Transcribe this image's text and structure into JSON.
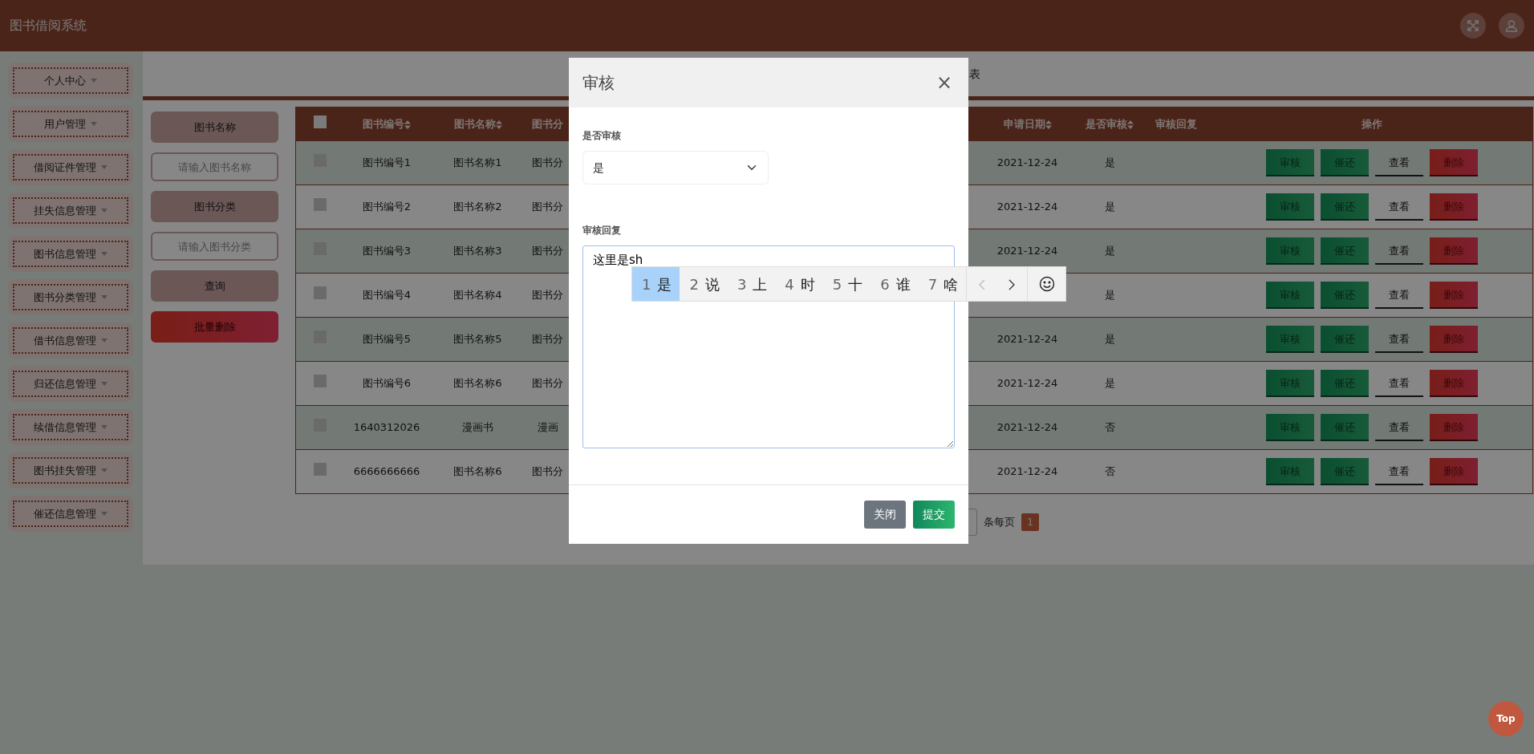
{
  "header": {
    "title": "图书借阅系统"
  },
  "sidebar": {
    "items": [
      {
        "label": "个人中心"
      },
      {
        "label": "用户管理"
      },
      {
        "label": "借阅证件管理"
      },
      {
        "label": "挂失信息管理"
      },
      {
        "label": "图书信息管理"
      },
      {
        "label": "图书分类管理"
      },
      {
        "label": "借书信息管理"
      },
      {
        "label": "归还信息管理"
      },
      {
        "label": "续借信息管理"
      },
      {
        "label": "图书挂失管理"
      },
      {
        "label": "催还信息管理"
      }
    ]
  },
  "page_title": "表",
  "search": {
    "fields": [
      {
        "label": "图书名称",
        "placeholder": "请输入图书名称"
      },
      {
        "label": "图书分类",
        "placeholder": "请输入图书分类"
      }
    ],
    "buttons": [
      {
        "label": "查询",
        "kind": "query"
      },
      {
        "label": "批量删除",
        "kind": "danger"
      }
    ]
  },
  "table": {
    "all_checked": false,
    "columns": [
      {
        "label": "图书编号",
        "sortable": true
      },
      {
        "label": "图书名称",
        "sortable": true
      },
      {
        "label": "图书分",
        "sortable": false
      },
      {
        "label": "申请日期",
        "sortable": true
      },
      {
        "label": "是否审核",
        "sortable": true
      },
      {
        "label": "审核回复",
        "sortable": false
      },
      {
        "label": "操作",
        "sortable": false
      }
    ],
    "rows": [
      {
        "checked": false,
        "cells": [
          "图书编号1",
          "图书名称1",
          "图书分",
          "2021-12-24",
          "是",
          ""
        ],
        "actions": [
          {
            "label": "审核",
            "kind": "success"
          },
          {
            "label": "催还",
            "kind": "success"
          },
          {
            "label": "查看",
            "kind": "link"
          },
          {
            "label": "删除",
            "kind": "danger"
          }
        ]
      },
      {
        "checked": false,
        "cells": [
          "图书编号2",
          "图书名称2",
          "图书分",
          "2021-12-24",
          "是",
          ""
        ],
        "actions": [
          {
            "label": "审核",
            "kind": "success"
          },
          {
            "label": "催还",
            "kind": "success"
          },
          {
            "label": "查看",
            "kind": "link"
          },
          {
            "label": "删除",
            "kind": "danger"
          }
        ]
      },
      {
        "checked": false,
        "cells": [
          "图书编号3",
          "图书名称3",
          "图书分",
          "2021-12-24",
          "是",
          ""
        ],
        "actions": [
          {
            "label": "审核",
            "kind": "success"
          },
          {
            "label": "催还",
            "kind": "success"
          },
          {
            "label": "查看",
            "kind": "link"
          },
          {
            "label": "删除",
            "kind": "danger"
          }
        ]
      },
      {
        "checked": false,
        "cells": [
          "图书编号4",
          "图书名称4",
          "图书分",
          "",
          "是",
          ""
        ],
        "actions": [
          {
            "label": "审核",
            "kind": "success"
          },
          {
            "label": "催还",
            "kind": "success"
          },
          {
            "label": "查看",
            "kind": "link"
          },
          {
            "label": "删除",
            "kind": "danger"
          }
        ]
      },
      {
        "checked": false,
        "cells": [
          "图书编号5",
          "图书名称5",
          "图书分",
          "2021-12-24",
          "是",
          ""
        ],
        "actions": [
          {
            "label": "审核",
            "kind": "success"
          },
          {
            "label": "催还",
            "kind": "success"
          },
          {
            "label": "查看",
            "kind": "link"
          },
          {
            "label": "删除",
            "kind": "danger"
          }
        ]
      },
      {
        "checked": false,
        "cells": [
          "图书编号6",
          "图书名称6",
          "图书分",
          "2021-12-24",
          "是",
          ""
        ],
        "actions": [
          {
            "label": "审核",
            "kind": "success"
          },
          {
            "label": "催还",
            "kind": "success"
          },
          {
            "label": "查看",
            "kind": "link"
          },
          {
            "label": "删除",
            "kind": "danger"
          }
        ]
      },
      {
        "checked": false,
        "cells": [
          "1640312026",
          "漫画书",
          "漫画",
          "2021-12-24",
          "否",
          ""
        ],
        "actions": [
          {
            "label": "审核",
            "kind": "success"
          },
          {
            "label": "催还",
            "kind": "success"
          },
          {
            "label": "查看",
            "kind": "link"
          },
          {
            "label": "删除",
            "kind": "danger"
          }
        ]
      },
      {
        "checked": false,
        "cells": [
          "6666666666",
          "图书名称6",
          "图书分",
          "2021-12-24",
          "否",
          ""
        ],
        "actions": [
          {
            "label": "审核",
            "kind": "success"
          },
          {
            "label": "催还",
            "kind": "success"
          },
          {
            "label": "查看",
            "kind": "link"
          },
          {
            "label": "删除",
            "kind": "danger"
          }
        ]
      }
    ]
  },
  "pagination": {
    "page_size_label": "条每页",
    "pages": [
      {
        "label": "1",
        "selected": true
      }
    ]
  },
  "modal": {
    "title": "审核",
    "close": "×",
    "fields": [
      {
        "label": "是否审核",
        "kind": "select",
        "value": "是"
      },
      {
        "label": "审核回复",
        "kind": "textarea",
        "value": "这里是sh"
      }
    ],
    "buttons": [
      {
        "label": "关闭",
        "kind": "secondary"
      },
      {
        "label": "提交",
        "kind": "primary"
      }
    ]
  },
  "ime": {
    "candidates": [
      {
        "number": "1",
        "text": "是",
        "selected": true
      },
      {
        "number": "2",
        "text": "说",
        "selected": false
      },
      {
        "number": "3",
        "text": "上",
        "selected": false
      },
      {
        "number": "4",
        "text": "时",
        "selected": false
      },
      {
        "number": "5",
        "text": "十",
        "selected": false
      },
      {
        "number": "6",
        "text": "谁",
        "selected": false
      },
      {
        "number": "7",
        "text": "啥",
        "selected": false
      }
    ]
  },
  "top_button": "Top"
}
